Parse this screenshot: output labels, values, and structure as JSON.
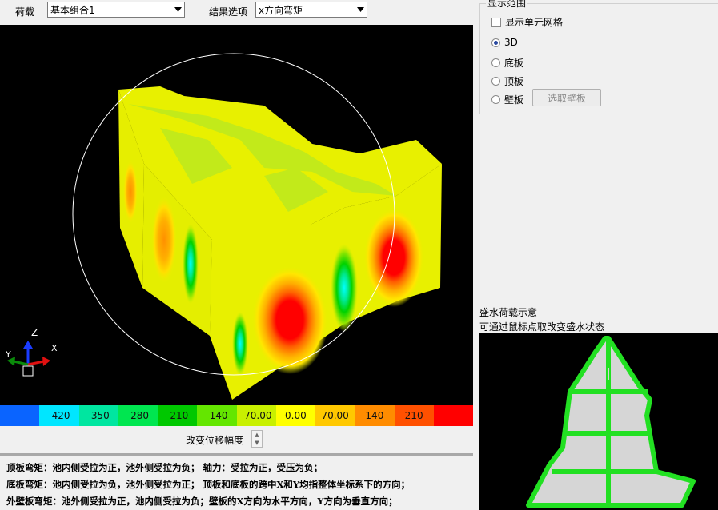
{
  "toolbar": {
    "load_label": "荷载",
    "load_value": "基本组合1",
    "result_label": "结果选项",
    "result_value": "x方向弯矩"
  },
  "axis": {
    "z": "Z",
    "x": "X",
    "y": "Y"
  },
  "colorbar": {
    "colors": [
      "#0a64ff",
      "#00e6ff",
      "#00e6a0",
      "#00e650",
      "#00c800",
      "#64e600",
      "#c8f000",
      "#ffff00",
      "#ffc800",
      "#ff8c00",
      "#ff5000",
      "#ff0000"
    ],
    "labels": [
      "",
      "-420",
      "-350",
      "-280",
      "-210",
      "-140",
      "-70.00",
      "0.00",
      "70.00",
      "140",
      "210",
      ""
    ]
  },
  "displacement_label": "改变位移幅度",
  "legend": {
    "line1": "顶板弯矩：池内侧受拉为正，池外侧受拉为负；   轴力：受拉为正，受压为负；",
    "line2": "底板弯矩：池内侧受拉为负，池外侧受拉为正；   顶板和底板的跨中X和Y均指整体坐标系下的方向；",
    "line3": "外壁板弯矩：池外侧受拉为正，池内侧受拉为负；壁板的X方向为水平方向，Y方向为垂直方向；"
  },
  "display_range": {
    "title": "显示范围",
    "show_mesh": "显示单元网格",
    "options": [
      "3D",
      "底板",
      "顶板",
      "壁板"
    ],
    "selected": "3D",
    "select_wall_button": "选取壁板"
  },
  "water_load": {
    "title": "盛水荷载示意",
    "hint": "可通过鼠标点取改变盛水状态"
  }
}
